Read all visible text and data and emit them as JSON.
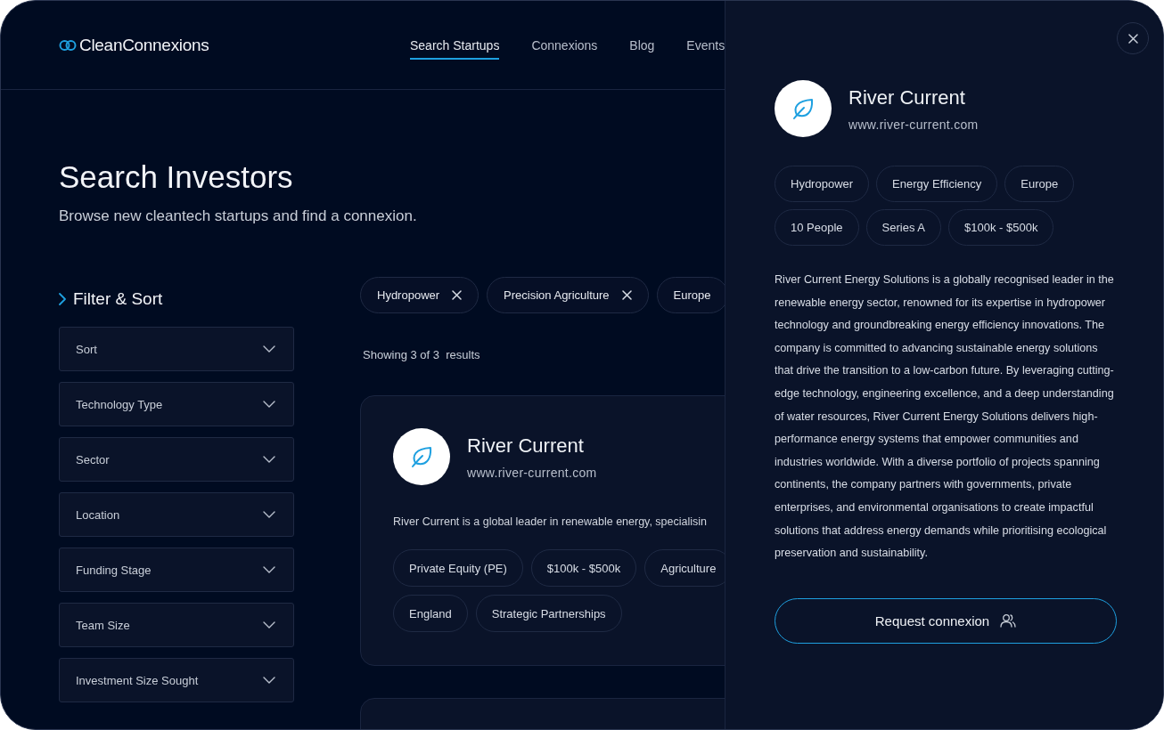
{
  "brand": {
    "name": "CleanConnexions"
  },
  "nav": [
    {
      "label": "Search Startups",
      "selected": true
    },
    {
      "label": "Connexions",
      "selected": false
    },
    {
      "label": "Blog",
      "selected": false
    },
    {
      "label": "Events",
      "selected": false
    }
  ],
  "page": {
    "title": "Search Investors",
    "subtitle": "Browse new cleantech startups and find a connexion."
  },
  "filters": {
    "title": "Filter & Sort",
    "dropdowns": [
      {
        "label": "Sort"
      },
      {
        "label": "Technology Type"
      },
      {
        "label": "Sector"
      },
      {
        "label": "Location"
      },
      {
        "label": "Funding Stage"
      },
      {
        "label": "Team Size"
      },
      {
        "label": "Investment Size Sought"
      }
    ]
  },
  "active_filters": [
    {
      "label": "Hydropower",
      "removable": true
    },
    {
      "label": "Precision Agriculture",
      "removable": true
    },
    {
      "label": "Europe",
      "removable": false
    }
  ],
  "results": {
    "summary": "Showing 3 of 3  results",
    "cards": [
      {
        "name": "River Current",
        "website": "www.river-current.com",
        "description": "River Current is a global leader in renewable energy, specialisin",
        "tags": [
          "Private Equity (PE)",
          "$100k - $500k",
          "Agriculture",
          "England",
          "Strategic Partnerships"
        ]
      }
    ]
  },
  "drawer": {
    "name": "River Current",
    "website": "www.river-current.com",
    "tags": [
      "Hydropower",
      "Energy Efficiency",
      "Europe",
      "10 People",
      "Series A",
      "$100k - $500k"
    ],
    "description": "River Current Energy Solutions is a globally recognised leader in the renewable energy sector, renowned for its expertise in hydropower technology and groundbreaking energy efficiency innovations. The company is committed to advancing sustainable energy solutions that drive the transition to a low-carbon future. By leveraging cutting-edge technology, engineering excellence, and a deep understanding of water resources, River Current Energy Solutions delivers high-performance energy systems that empower communities and industries worldwide. With a diverse portfolio of projects spanning continents, the company partners with governments, private enterprises, and environmental organisations to create impactful solutions that address energy demands while prioritising ecological preservation and sustainability.",
    "action": "Request connexion"
  }
}
